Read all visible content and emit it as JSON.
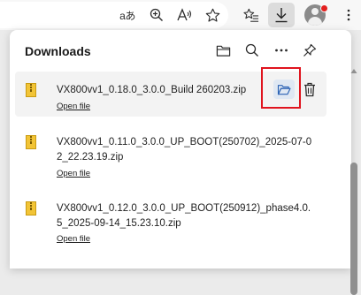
{
  "toolbar": {
    "read_aloud_label": "aあ",
    "icons": [
      "read-aloud",
      "zoom",
      "text-size",
      "favorite",
      "favorites-list",
      "downloads",
      "profile"
    ]
  },
  "downloads": {
    "title": "Downloads",
    "header_icons": [
      "open-folder",
      "search",
      "more",
      "pin"
    ],
    "open_file_label": "Open file",
    "items": [
      {
        "name": "VX800vv1_0.18.0_3.0.0_Build 260203.zip",
        "action": "Open file",
        "selected": true
      },
      {
        "name": "VX800vv1_0.11.0_3.0.0_UP_BOOT(250702)_2025-07-02_22.23.19.zip",
        "action": "Open file",
        "selected": false
      },
      {
        "name": "VX800vv1_0.12.0_3.0.0_UP_BOOT(250912)_phase4.0.5_2025-09-14_15.23.10.zip",
        "action": "Open file",
        "selected": false
      }
    ]
  },
  "colors": {
    "highlight": "#e0141e",
    "notification": "#e3201f",
    "folder_button_bg": "#dfe8f3",
    "zip_icon": "#f2c436"
  }
}
